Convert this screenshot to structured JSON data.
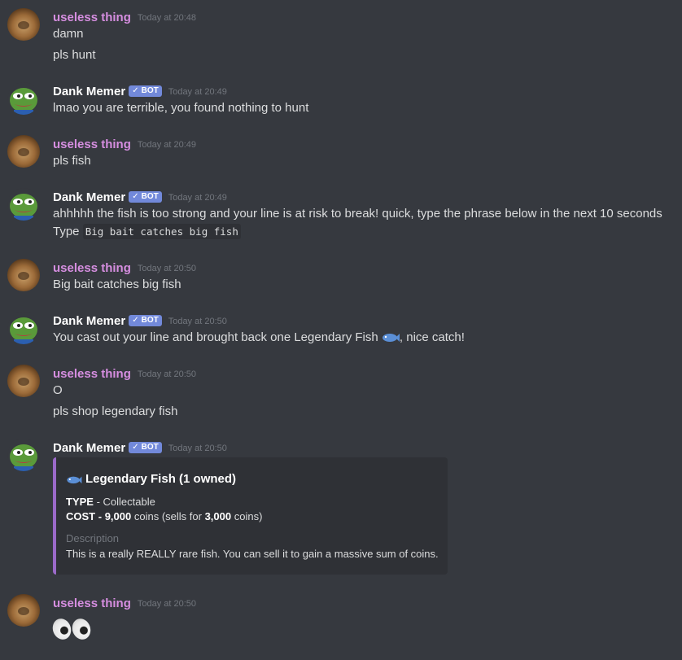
{
  "messages": [
    {
      "author": "useless thing",
      "time": "Today at 20:48",
      "lines": [
        "damn",
        "pls hunt"
      ]
    },
    {
      "author": "Dank Memer",
      "bot_badge": "BOT",
      "time": "Today at 20:49",
      "lines": [
        "lmao you are terrible, you found nothing to hunt"
      ]
    },
    {
      "author": "useless thing",
      "time": "Today at 20:49",
      "lines": [
        "pls fish"
      ]
    },
    {
      "author": "Dank Memer",
      "bot_badge": "BOT",
      "time": "Today at 20:49",
      "lines": [
        "ahhhhh the fish is too strong and your line is at risk to break! quick, type the phrase below in the next 10 seconds"
      ],
      "type_prefix": "Type",
      "type_code": "Big bait catches big fish"
    },
    {
      "author": "useless thing",
      "time": "Today at 20:50",
      "lines": [
        "Big bait catches big fish"
      ]
    },
    {
      "author": "Dank Memer",
      "bot_badge": "BOT",
      "time": "Today at 20:50",
      "catch_before": "You cast out your line and brought back one Legendary Fish",
      "catch_after": ", nice catch!"
    },
    {
      "author": "useless thing",
      "time": "Today at 20:50",
      "lines": [
        "O",
        "pls shop legendary fish"
      ]
    },
    {
      "author": "Dank Memer",
      "bot_badge": "BOT",
      "time": "Today at 20:50",
      "embed": {
        "title": "Legendary Fish (1 owned)",
        "type_label": "TYPE",
        "type_value": "- Collectable",
        "cost_label": "COST -",
        "cost_value": "9,000",
        "cost_mid": "coins (sells for",
        "sell_value": "3,000",
        "cost_end": "coins)",
        "description_label": "Description",
        "description": "This is a really REALLY rare fish. You can sell it to gain a massive sum of coins."
      }
    },
    {
      "author": "useless thing",
      "time": "Today at 20:50"
    }
  ],
  "colors": {
    "user_name": "#d68ee0",
    "badge": "#7289da",
    "embed_border": "#9b6ac9",
    "background": "#36393f"
  },
  "icons": {
    "bot_badge": "checkmark-icon",
    "fish": "fish-emoji-icon",
    "eyes": "eyes-emoji-icon"
  }
}
